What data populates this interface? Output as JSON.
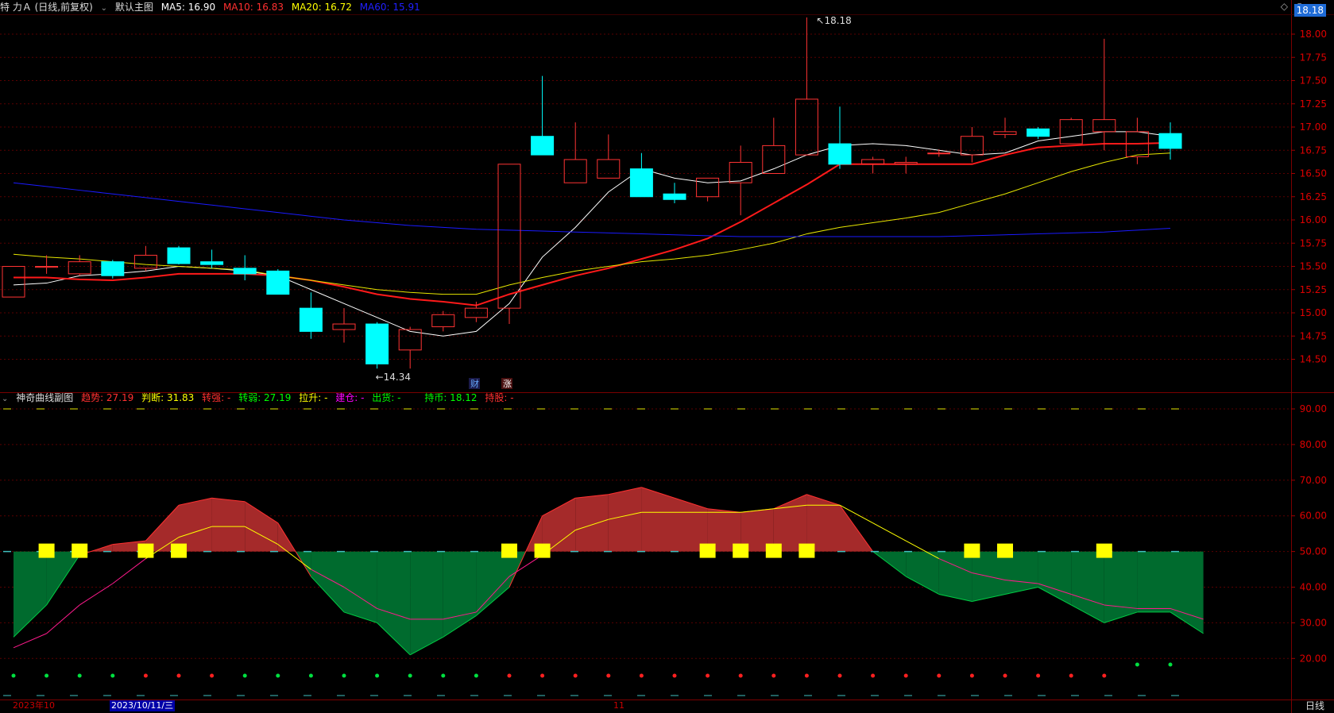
{
  "main_header": {
    "stock": "特 力Ａ (日线,前复权)",
    "chart_name": "默认主图",
    "ma5": "MA5: 16.90",
    "ma10": "MA10: 16.83",
    "ma20": "MA20: 16.72",
    "ma60": "MA60: 15.91"
  },
  "price_tag": "18.18",
  "sub_header": {
    "name": "神奇曲线副图",
    "trend": "趋势: 27.19",
    "judge": "判断: 31.83",
    "turn_strong": "转强: -",
    "turn_weak": "转弱: 27.19",
    "pull_up": "拉升: -",
    "build": "建仓: -",
    "sell": "出货: -",
    "hold": "持币: 18.12",
    "hold_stock": "持股: -"
  },
  "annotations": {
    "high": "18.18",
    "low": "14.34",
    "fin": "财",
    "rise": "涨"
  },
  "bottom": {
    "date_left": "2023年10",
    "date_sel": "2023/10/11/三",
    "month": "11",
    "period": "日线"
  },
  "colors": {
    "up": "#ff3333",
    "down": "#00ffff",
    "ma5": "#ffffff",
    "ma10": "#ff1a1a",
    "ma20": "#e6e600",
    "ma60": "#1a1aff"
  },
  "chart_data": [
    {
      "type": "candlestick",
      "title": "默认主图",
      "ylim": [
        14.3,
        18.2
      ],
      "yticks": [
        "18.00",
        "17.75",
        "17.50",
        "17.25",
        "17.00",
        "16.75",
        "16.50",
        "16.25",
        "16.00",
        "15.75",
        "15.50",
        "15.25",
        "15.00",
        "14.75",
        "14.50"
      ],
      "candles": [
        {
          "o": 15.17,
          "h": 15.5,
          "l": 15.17,
          "c": 15.5
        },
        {
          "o": 15.49,
          "h": 15.62,
          "l": 15.42,
          "c": 15.5
        },
        {
          "o": 15.42,
          "h": 15.62,
          "l": 15.4,
          "c": 15.55
        },
        {
          "o": 15.55,
          "h": 15.57,
          "l": 15.37,
          "c": 15.4
        },
        {
          "o": 15.48,
          "h": 15.72,
          "l": 15.45,
          "c": 15.62
        },
        {
          "o": 15.7,
          "h": 15.72,
          "l": 15.52,
          "c": 15.53
        },
        {
          "o": 15.55,
          "h": 15.68,
          "l": 15.48,
          "c": 15.52
        },
        {
          "o": 15.48,
          "h": 15.62,
          "l": 15.35,
          "c": 15.42
        },
        {
          "o": 15.45,
          "h": 15.47,
          "l": 15.22,
          "c": 15.2
        },
        {
          "o": 15.05,
          "h": 15.22,
          "l": 14.72,
          "c": 14.8
        },
        {
          "o": 14.82,
          "h": 15.05,
          "l": 14.68,
          "c": 14.88
        },
        {
          "o": 14.88,
          "h": 14.9,
          "l": 14.4,
          "c": 14.45
        },
        {
          "o": 14.6,
          "h": 14.85,
          "l": 14.4,
          "c": 14.82
        },
        {
          "o": 14.85,
          "h": 15.02,
          "l": 14.8,
          "c": 14.98
        },
        {
          "o": 14.95,
          "h": 15.12,
          "l": 14.9,
          "c": 15.05
        },
        {
          "o": 15.05,
          "h": 16.6,
          "l": 14.88,
          "c": 16.6
        },
        {
          "o": 16.9,
          "h": 17.55,
          "l": 16.7,
          "c": 16.7
        },
        {
          "o": 16.4,
          "h": 17.05,
          "l": 16.4,
          "c": 16.65
        },
        {
          "o": 16.45,
          "h": 16.92,
          "l": 16.45,
          "c": 16.65
        },
        {
          "o": 16.55,
          "h": 16.72,
          "l": 16.25,
          "c": 16.25
        },
        {
          "o": 16.28,
          "h": 16.4,
          "l": 16.18,
          "c": 16.22
        },
        {
          "o": 16.25,
          "h": 16.45,
          "l": 16.2,
          "c": 16.45
        },
        {
          "o": 16.4,
          "h": 16.8,
          "l": 16.05,
          "c": 16.62
        },
        {
          "o": 16.5,
          "h": 17.1,
          "l": 16.5,
          "c": 16.8
        },
        {
          "o": 16.7,
          "h": 18.18,
          "l": 16.7,
          "c": 17.3
        },
        {
          "o": 16.82,
          "h": 17.22,
          "l": 16.55,
          "c": 16.6
        },
        {
          "o": 16.6,
          "h": 16.68,
          "l": 16.5,
          "c": 16.65
        },
        {
          "o": 16.6,
          "h": 16.68,
          "l": 16.5,
          "c": 16.62
        },
        {
          "o": 16.72,
          "h": 16.76,
          "l": 16.68,
          "c": 16.72
        },
        {
          "o": 16.7,
          "h": 17.0,
          "l": 16.62,
          "c": 16.9
        },
        {
          "o": 16.92,
          "h": 17.1,
          "l": 16.88,
          "c": 16.95
        },
        {
          "o": 16.98,
          "h": 17.0,
          "l": 16.87,
          "c": 16.9
        },
        {
          "o": 16.82,
          "h": 17.1,
          "l": 16.82,
          "c": 17.08
        },
        {
          "o": 16.95,
          "h": 17.95,
          "l": 16.75,
          "c": 17.08
        },
        {
          "o": 16.68,
          "h": 17.1,
          "l": 16.6,
          "c": 16.95
        },
        {
          "o": 16.93,
          "h": 17.05,
          "l": 16.65,
          "c": 16.77
        }
      ],
      "series": [
        {
          "name": "MA5",
          "values": [
            15.3,
            15.32,
            15.4,
            15.42,
            15.45,
            15.5,
            15.48,
            15.45,
            15.4,
            15.25,
            15.1,
            14.95,
            14.8,
            14.75,
            14.8,
            15.1,
            15.6,
            15.92,
            16.3,
            16.55,
            16.45,
            16.4,
            16.42,
            16.55,
            16.7,
            16.8,
            16.82,
            16.8,
            16.75,
            16.7,
            16.72,
            16.85,
            16.9,
            16.95,
            16.95,
            16.9
          ]
        },
        {
          "name": "MA10",
          "values": [
            15.38,
            15.38,
            15.36,
            15.35,
            15.38,
            15.42,
            15.42,
            15.42,
            15.4,
            15.35,
            15.28,
            15.2,
            15.15,
            15.12,
            15.08,
            15.2,
            15.3,
            15.4,
            15.48,
            15.58,
            15.68,
            15.8,
            15.98,
            16.18,
            16.38,
            16.6,
            16.6,
            16.6,
            16.6,
            16.6,
            16.7,
            16.78,
            16.8,
            16.82,
            16.82,
            16.83
          ]
        },
        {
          "name": "MA20",
          "values": [
            15.63,
            15.6,
            15.58,
            15.55,
            15.52,
            15.5,
            15.48,
            15.46,
            15.4,
            15.35,
            15.3,
            15.25,
            15.22,
            15.2,
            15.2,
            15.3,
            15.38,
            15.45,
            15.5,
            15.55,
            15.58,
            15.62,
            15.68,
            15.75,
            15.85,
            15.92,
            15.97,
            16.02,
            16.08,
            16.18,
            16.28,
            16.4,
            16.52,
            16.62,
            16.7,
            16.72
          ]
        },
        {
          "name": "MA60",
          "values": [
            16.4,
            16.36,
            16.32,
            16.28,
            16.24,
            16.2,
            16.16,
            16.12,
            16.08,
            16.04,
            16.0,
            15.97,
            15.94,
            15.92,
            15.9,
            15.89,
            15.88,
            15.87,
            15.86,
            15.85,
            15.84,
            15.83,
            15.82,
            15.82,
            15.82,
            15.82,
            15.82,
            15.82,
            15.82,
            15.83,
            15.84,
            15.85,
            15.86,
            15.87,
            15.89,
            15.91
          ]
        }
      ]
    },
    {
      "type": "area",
      "title": "神奇曲线副图",
      "ylim": [
        10,
        95
      ],
      "yticks": [
        "90.00",
        "80.00",
        "70.00",
        "60.00",
        "50.00",
        "40.00",
        "30.00",
        "20.00"
      ],
      "baseline": 50,
      "series": [
        {
          "name": "趋势",
          "values": [
            26,
            35,
            49,
            52,
            53,
            63,
            65,
            64,
            58,
            43,
            33,
            30,
            21,
            26,
            32,
            40,
            60,
            65,
            66,
            68,
            65,
            62,
            61,
            62,
            66,
            63,
            50,
            43,
            38,
            36,
            38,
            40,
            35,
            30,
            33,
            33,
            27
          ]
        },
        {
          "name": "判断",
          "values": [
            23,
            27,
            35,
            41,
            48,
            54,
            57,
            57,
            52,
            45,
            40,
            34,
            31,
            31,
            33,
            43,
            49,
            56,
            59,
            61,
            61,
            61,
            61,
            62,
            63,
            63,
            58,
            53,
            48,
            44,
            42,
            41,
            38,
            35,
            34,
            34,
            31
          ]
        }
      ],
      "markers_at": [
        1,
        2,
        4,
        5,
        15,
        16,
        21,
        22,
        23,
        24,
        29,
        30,
        33
      ],
      "dots": [
        "g",
        "g",
        "g",
        "g",
        "r",
        "r",
        "r",
        "g",
        "g",
        "g",
        "g",
        "g",
        "g",
        "g",
        "g",
        "r",
        "r",
        "r",
        "r",
        "r",
        "r",
        "r",
        "r",
        "r",
        "r",
        "r",
        "r",
        "r",
        "r",
        "r",
        "r",
        "r",
        "r",
        "r",
        "g",
        "g"
      ],
      "dashed_levels": [
        90,
        50,
        9
      ]
    }
  ]
}
